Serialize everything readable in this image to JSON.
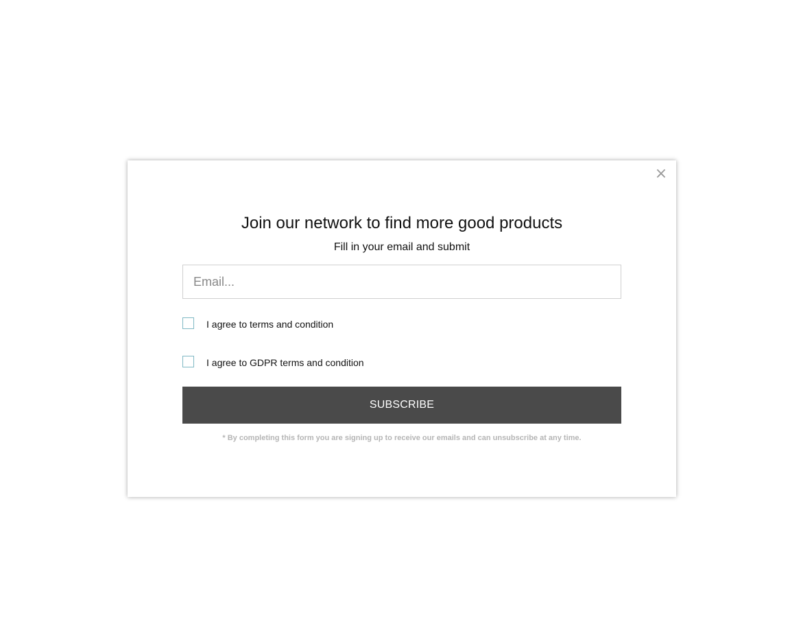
{
  "modal": {
    "close_symbol": "×",
    "title": "Join our network to find more good products",
    "subtitle": "Fill in your email and submit",
    "email": {
      "placeholder": "Email...",
      "value": ""
    },
    "checkboxes": [
      {
        "label": "I agree to terms and condition",
        "checked": false
      },
      {
        "label": "I agree to GDPR terms and condition",
        "checked": false
      }
    ],
    "subscribe_label": "SUBSCRIBE",
    "disclaimer": "* By completing this form you are signing up to receive our emails and can unsubscribe at any time."
  },
  "colors": {
    "button_bg": "#4a4a4a",
    "checkbox_border": "#7fb8c4",
    "disclaimer_text": "#b5b5b5"
  },
  "icons": {
    "close": "close-icon"
  }
}
